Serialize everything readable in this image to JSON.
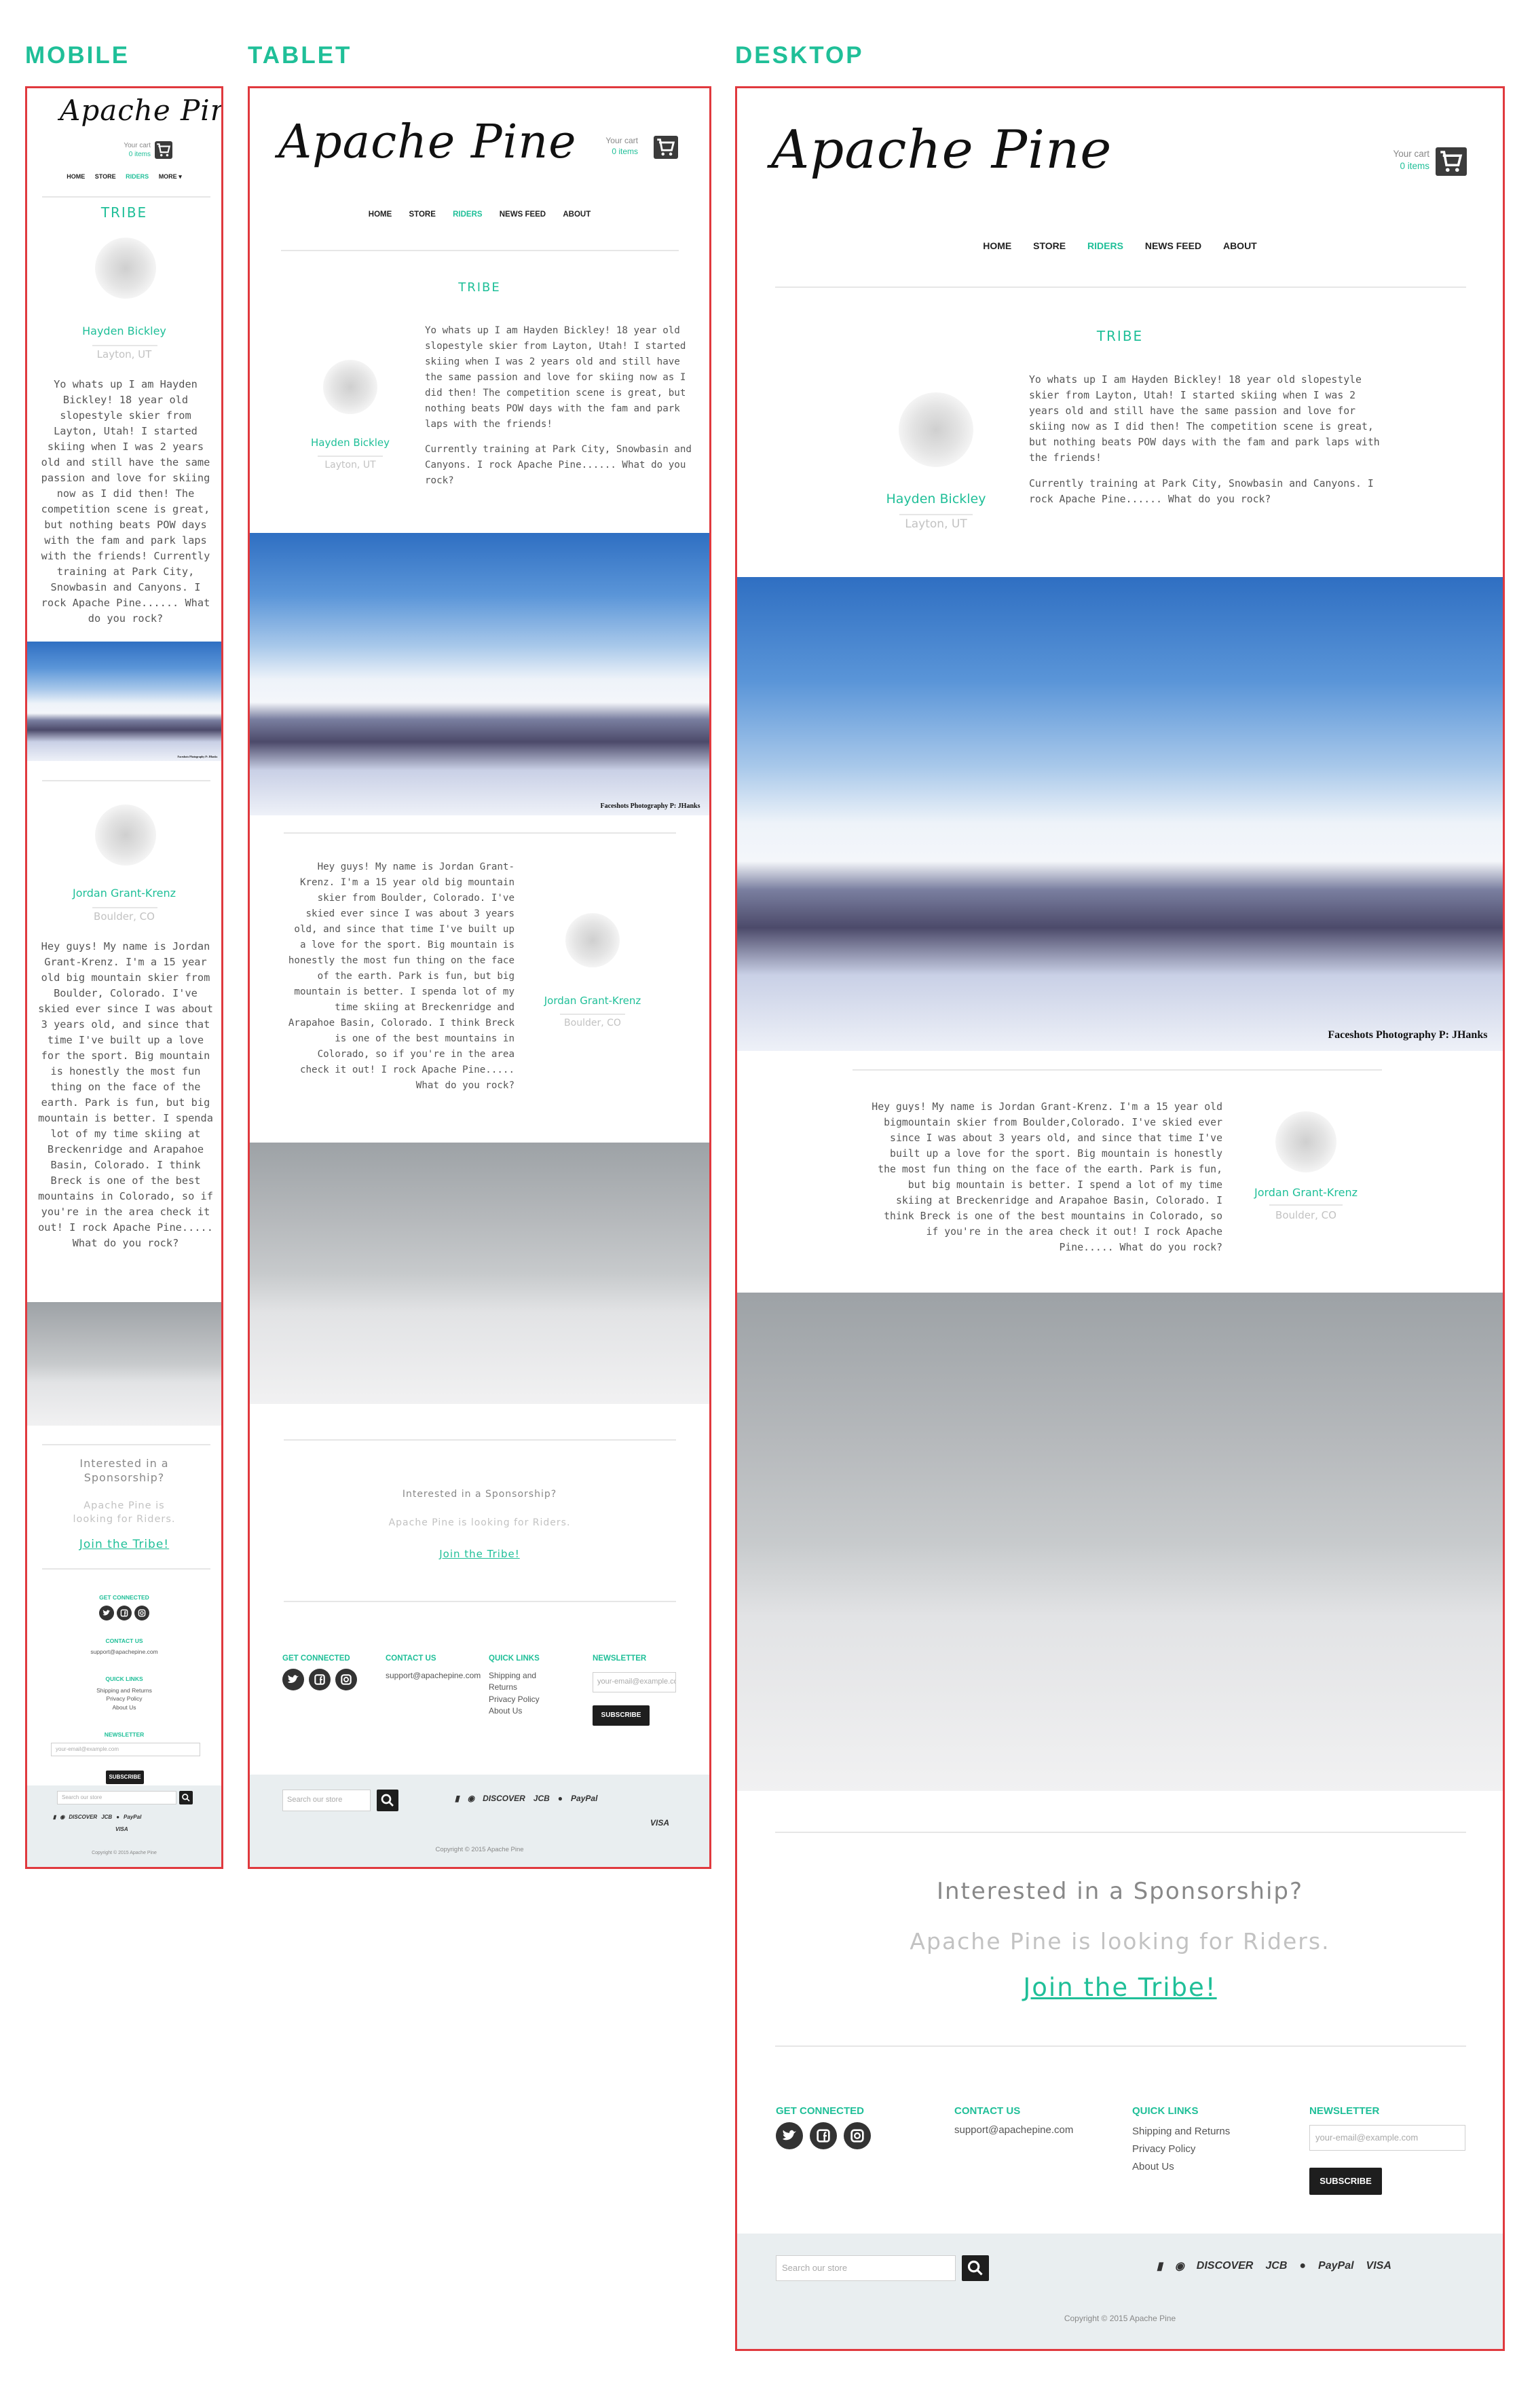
{
  "labels": {
    "mobile": "MOBILE",
    "tablet": "TABLET",
    "desktop": "DESKTOP"
  },
  "site": {
    "logo": "Apache Pine",
    "cart": {
      "label": "Your cart",
      "items": "0 items"
    },
    "nav": [
      "HOME",
      "STORE",
      "RIDERS",
      "NEWS FEED",
      "ABOUT"
    ],
    "nav_mobile": [
      "HOME",
      "STORE",
      "RIDERS",
      "MORE ▾"
    ],
    "nav_active": "RIDERS",
    "heading": "TRIBE",
    "riders": [
      {
        "name": "Hayden Bickley",
        "location": "Layton, UT",
        "bio_p1": "Yo whats up I am Hayden Bickley! 18 year old slopestyle skier from Layton, Utah! I started skiing when I was 2 years old and still have the same passion and love for skiing now as I did then! The competition scene is great, but nothing beats POW days with the fam and park laps with the friends!",
        "bio_p2": "Currently training at Park City, Snowbasin and Canyons.  I rock Apache Pine...... What do you rock?",
        "bio_mobile": "Yo whats up I am Hayden Bickley! 18 year old slopestyle skier from Layton, Utah! I started skiing when I was 2 years old and still have the same passion and love for skiing now as I did then! The competition scene is great, but nothing beats POW days with the fam and park laps with the friends! Currently training at Park City, Snowbasin and Canyons.  I rock Apache Pine...... What do you rock?",
        "photo_credit": "Faceshots Photography P: JHanks",
        "photo_icon": "skier-air-photo"
      },
      {
        "name": "Jordan Grant-Krenz",
        "location": "Boulder, CO",
        "bio": "Hey guys! My name is Jordan Grant-Krenz. I'm a 15 year old big mountain skier from Boulder, Colorado. I've skied ever since I was about 3 years old, and since that time I've built up a love for the sport. Big mountain is honestly the most fun thing on the face of the earth. Park is fun, but big mountain is better. I spenda lot of my time skiing at Breckenridge and Arapahoe Basin, Colorado. I think Breck is one of the best mountains in Colorado, so if you're in the area check it out!  I rock Apache Pine..... What do you rock?",
        "bio_desktop": "Hey guys! My name is Jordan Grant-Krenz. I'm a 15 year old bigmountain skier from Boulder,Colorado. I've skied ever since I was about 3 years old, and since that time I've built up a love for the sport. Big mountain is honestly the most fun thing on the face of the earth. Park is fun, but big mountain is better. I spend a lot of my time skiing at Breckenridge and Arapahoe Basin, Colorado. I think Breck is one of the best mountains in Colorado, so if you're in the area check it out!  I rock Apache Pine..... What do you rock?",
        "photo_icon": "powder-trees-photo"
      }
    ],
    "cta": {
      "question": "Interested in a Sponsorship?",
      "sub": "Apache Pine is  looking for Riders.",
      "link": "Join the Tribe!"
    },
    "footer": {
      "get_connected": "GET CONNECTED",
      "contact_us": "CONTACT US",
      "email": "support@apachepine.com",
      "quick_links": "QUICK LINKS",
      "links": [
        "Shipping and Returns",
        "Privacy Policy",
        "About Us"
      ],
      "newsletter": "NEWSLETTER",
      "email_placeholder": "your-email@example.com",
      "subscribe": "SUBSCRIBE",
      "search_placeholder": "Search our store",
      "payments": [
        "AMEX",
        "DINERS",
        "DISCOVER",
        "JCB",
        "MASTER",
        "PayPal",
        "VISA"
      ],
      "copyright": "Copyright © 2015 Apache Pine"
    },
    "colors": {
      "accent": "#1fbf98",
      "frame": "#e0393e",
      "dark": "#1e1e1e",
      "footer_bg": "#e9eef0"
    }
  }
}
